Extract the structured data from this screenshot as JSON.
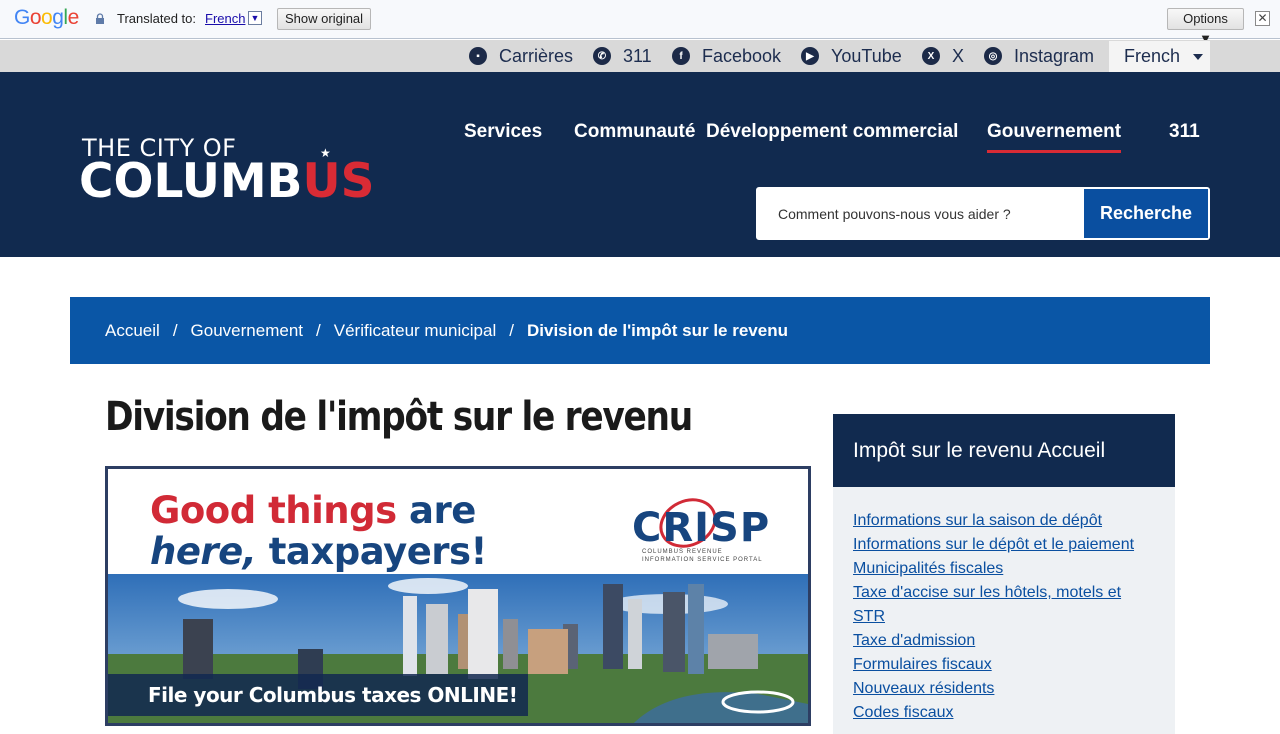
{
  "translate_bar": {
    "label": "Translated to:",
    "language": "French",
    "show_original": "Show original",
    "options": "Options ▼",
    "close": "✕"
  },
  "utility_nav": {
    "items": [
      {
        "label": "Carrières",
        "icon": "briefcase-icon"
      },
      {
        "label": "311",
        "icon": "phone-icon"
      },
      {
        "label": "Facebook",
        "icon": "facebook-icon"
      },
      {
        "label": "YouTube",
        "icon": "youtube-icon"
      },
      {
        "label": "X",
        "icon": "x-icon"
      },
      {
        "label": "Instagram",
        "icon": "instagram-icon"
      }
    ],
    "language": "French"
  },
  "header": {
    "logo_top": "THE CITY OF",
    "logo_bottom_a": "COLUMB",
    "logo_bottom_b": "US",
    "nav": [
      "Services",
      "Communauté",
      "Développement commercial",
      "Gouvernement",
      "311"
    ],
    "search_placeholder": "Comment pouvons-nous vous aider ?",
    "search_button": "Recherche"
  },
  "breadcrumb": [
    "Accueil",
    "Gouvernement",
    "Vérificateur municipal",
    "Division de l'impôt sur le revenu"
  ],
  "main": {
    "title": "Division de l'impôt sur le revenu",
    "banner": {
      "line1_red": "Good things",
      "line1_blue": "are",
      "line2_italic": "here,",
      "line2_rest": "taxpayers!",
      "crisp": "CRISP",
      "crisp_sub1": "COLUMBUS REVENUE",
      "crisp_sub2": "INFORMATION SERVICE PORTAL",
      "cta": "File your Columbus taxes ONLINE!"
    }
  },
  "sidebar": {
    "heading": "Impôt sur le revenu Accueil",
    "links": [
      "Informations sur la saison de dépôt",
      "Informations sur le dépôt et le paiement",
      "Municipalités fiscales",
      "Taxe d'accise sur les hôtels, motels et STR",
      "Taxe d'admission",
      "Formulaires fiscaux",
      "Nouveaux résidents",
      "Codes fiscaux"
    ]
  },
  "colors": {
    "navy": "#112a4f",
    "accent_blue": "#0a56a6",
    "accent_red": "#d92b35"
  }
}
